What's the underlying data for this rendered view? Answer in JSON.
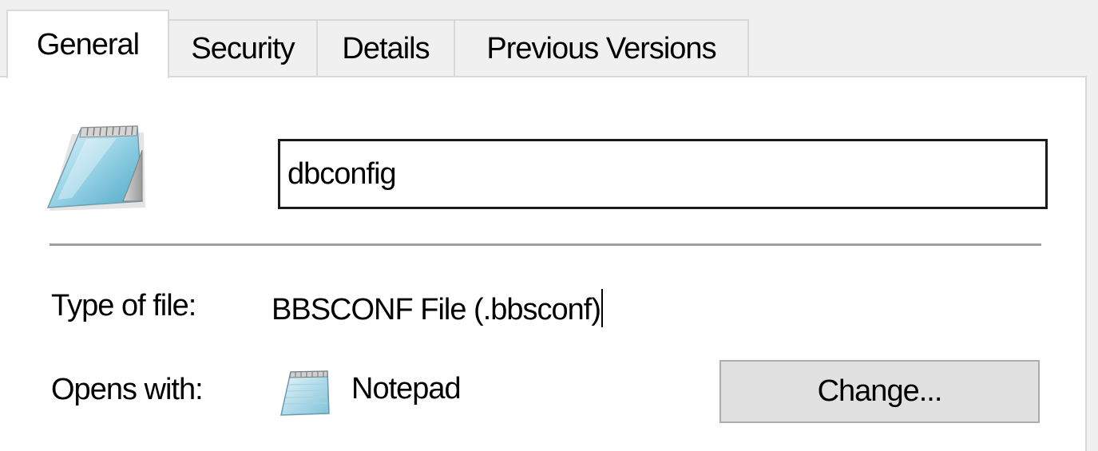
{
  "tabs": [
    {
      "label": "General",
      "active": true
    },
    {
      "label": "Security",
      "active": false
    },
    {
      "label": "Details",
      "active": false
    },
    {
      "label": "Previous Versions",
      "active": false
    }
  ],
  "general": {
    "file_icon": "notepad-document-icon",
    "file_name": "dbconfig",
    "type_label": "Type of file:",
    "type_value": "BBSCONF File (.bbsconf)",
    "opens_label": "Opens with:",
    "opens_icon": "notepad-app-icon",
    "opens_value": "Notepad",
    "change_label": "Change..."
  },
  "colors": {
    "panel_bg": "#ffffff",
    "window_bg": "#f0f0f0",
    "tab_border": "#d9d9d9",
    "button_bg": "#e1e1e1",
    "button_border": "#adadad",
    "divider": "#a0a0a0"
  }
}
